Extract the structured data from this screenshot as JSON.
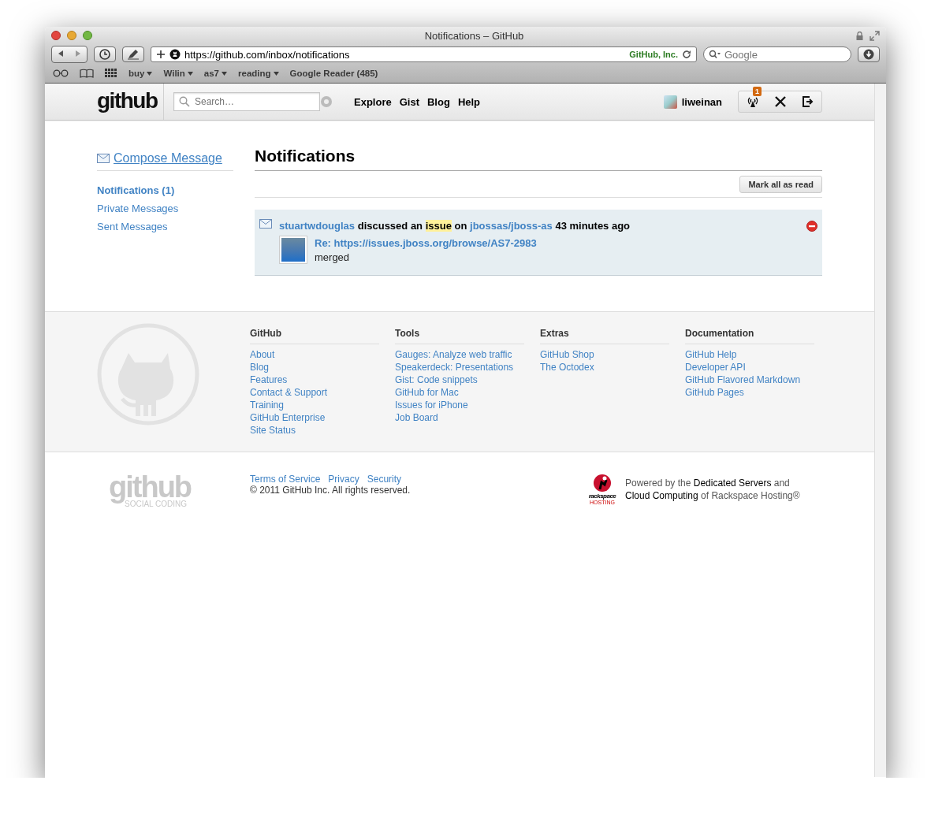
{
  "window": {
    "title": "Notifications – GitHub"
  },
  "toolbar": {
    "url": "https://github.com/inbox/notifications",
    "site_identity": "GitHub, Inc.",
    "search_placeholder": "Google"
  },
  "bookmarks": [
    {
      "label": "buy",
      "menu": true
    },
    {
      "label": "Wilin",
      "menu": true
    },
    {
      "label": "as7",
      "menu": true
    },
    {
      "label": "reading",
      "menu": true
    },
    {
      "label": "Google Reader (485)",
      "menu": false
    }
  ],
  "header": {
    "logo": "github",
    "search_placeholder": "Search…",
    "nav": [
      "Explore",
      "Gist",
      "Blog",
      "Help"
    ],
    "username": "liweinan",
    "notification_count": "1"
  },
  "sidebar": {
    "compose": "Compose Message",
    "items": [
      {
        "label": "Notifications (1)",
        "selected": true
      },
      {
        "label": "Private Messages",
        "selected": false
      },
      {
        "label": "Sent Messages",
        "selected": false
      }
    ]
  },
  "main": {
    "title": "Notifications",
    "mark_all_button": "Mark all as read",
    "notifications": [
      {
        "actor": "stuartwdouglas",
        "verb": "discussed an",
        "subject": "issue",
        "preposition": "on",
        "repo": "jbossas/jboss-as",
        "time": "43 minutes ago",
        "link": "Re: https://issues.jboss.org/browse/AS7-2983",
        "body": "merged"
      }
    ]
  },
  "footer": {
    "columns": [
      {
        "heading": "GitHub",
        "links": [
          "About",
          "Blog",
          "Features",
          "Contact & Support",
          "Training",
          "GitHub Enterprise",
          "Site Status"
        ]
      },
      {
        "heading": "Tools",
        "links": [
          "Gauges: Analyze web traffic",
          "Speakerdeck: Presentations",
          "Gist: Code snippets",
          "GitHub for Mac",
          "Issues for iPhone",
          "Job Board"
        ]
      },
      {
        "heading": "Extras",
        "links": [
          "GitHub Shop",
          "The Octodex"
        ]
      },
      {
        "heading": "Documentation",
        "links": [
          "GitHub Help",
          "Developer API",
          "GitHub Flavored Markdown",
          "GitHub Pages"
        ]
      }
    ],
    "legal_links": [
      "Terms of Service",
      "Privacy",
      "Security"
    ],
    "copyright": "© 2011 GitHub Inc. All rights reserved.",
    "logo": "github",
    "logo_tagline": "SOCIAL CODING",
    "sponsor_logo": "rackspace",
    "sponsor_logo_sub": "HOSTING",
    "powered_by": "Powered by the **Dedicated Servers** and **Cloud Computing** of Rackspace Hosting®"
  }
}
